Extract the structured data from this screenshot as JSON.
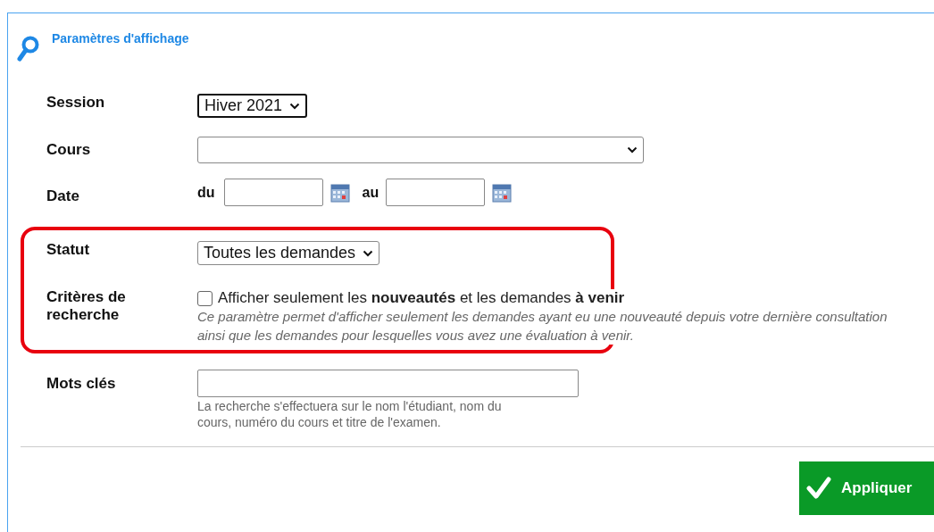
{
  "panel": {
    "title": "Paramètres d'affichage"
  },
  "fields": [
    {
      "kind": "select",
      "label": "Session",
      "value": "Hiver 2021"
    },
    {
      "kind": "select-wide",
      "label": "Cours"
    },
    {
      "kind": "date-range",
      "label": "Date",
      "from_label": "du",
      "to_label": "au"
    },
    {
      "kind": "select",
      "label": "Statut",
      "value": "Toutes les demandes"
    },
    {
      "kind": "checkbox",
      "label": "Critères de recherche",
      "checked": false,
      "text": "Afficher seulement les **nouveautés** et les demandes **à venir**",
      "help": "Ce paramètre permet d'afficher seulement les demandes ayant eu une nouveauté depuis votre dernière consultation ainsi que les demandes pour lesquelles vous avez une évaluation à venir."
    },
    {
      "kind": "text",
      "label": "Mots clés",
      "help": "La recherche s'effectuera sur le nom l'étudiant, nom du cours, numéro du cours et titre de l'examen."
    }
  ],
  "apply_button": {
    "label": "Appliquer"
  }
}
